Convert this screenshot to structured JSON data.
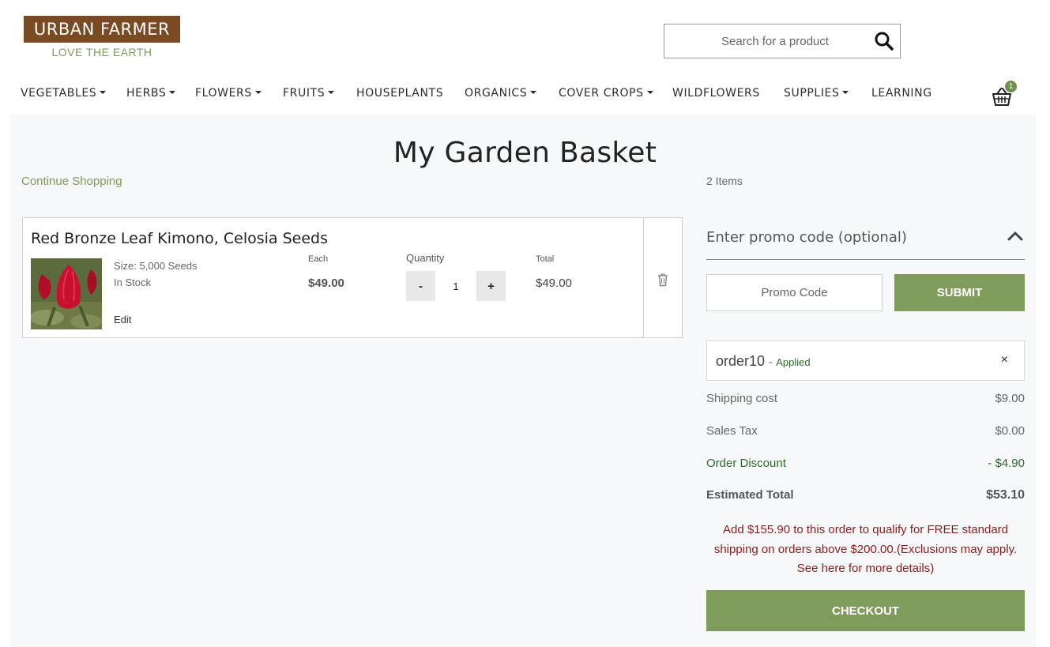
{
  "header": {
    "logo_title": "URBAN FARMER",
    "logo_tagline": "LOVE THE EARTH",
    "search_placeholder": "Search for a product",
    "cart_count": "1"
  },
  "nav": [
    {
      "label": "VEGETABLES",
      "dropdown": true
    },
    {
      "label": "HERBS",
      "dropdown": true
    },
    {
      "label": "FLOWERS",
      "dropdown": true
    },
    {
      "label": "FRUITS",
      "dropdown": true
    },
    {
      "label": "HOUSEPLANTS",
      "dropdown": false
    },
    {
      "label": "ORGANICS",
      "dropdown": true
    },
    {
      "label": "COVER CROPS",
      "dropdown": true
    },
    {
      "label": "WILDFLOWERS",
      "dropdown": false
    },
    {
      "label": "SUPPLIES",
      "dropdown": true
    },
    {
      "label": "LEARNING",
      "dropdown": false
    }
  ],
  "page": {
    "title": "My Garden Basket",
    "continue_shopping": "Continue Shopping",
    "items_count": "2 Items"
  },
  "cart_item": {
    "name": "Red Bronze Leaf Kimono, Celosia Seeds",
    "size": "Size: 5,000 Seeds",
    "stock": "In Stock",
    "edit_label": "Edit",
    "each_label": "Each",
    "each_price": "$49.00",
    "quantity_label": "Quantity",
    "quantity": "1",
    "minus_label": "-",
    "plus_label": "+",
    "total_label": "Total",
    "total_price": "$49.00"
  },
  "promo": {
    "toggle_label": "Enter promo code (optional)",
    "input_placeholder": "Promo Code",
    "submit_label": "SUBMIT",
    "applied_code": "order10",
    "applied_separator": " - ",
    "applied_status": "Applied",
    "remove_symbol": "×"
  },
  "summary": {
    "shipping_label": "Shipping cost",
    "shipping_value": "$9.00",
    "tax_label": "Sales Tax",
    "tax_value": "$0.00",
    "discount_label": "Order Discount",
    "discount_value": "- $4.90",
    "total_label": "Estimated Total",
    "total_value": "$53.10",
    "free_shipping_note": "Add $155.90 to this order to qualify for FREE standard shipping on orders above $200.00.(Exclusions may apply. See here for more details)",
    "checkout_label": "CHECKOUT"
  },
  "colors": {
    "brand_brown": "#7a4a22",
    "brand_green": "#7f9c5c",
    "discount_green": "#2d6b2d",
    "notice_red": "#8b1d1d"
  }
}
